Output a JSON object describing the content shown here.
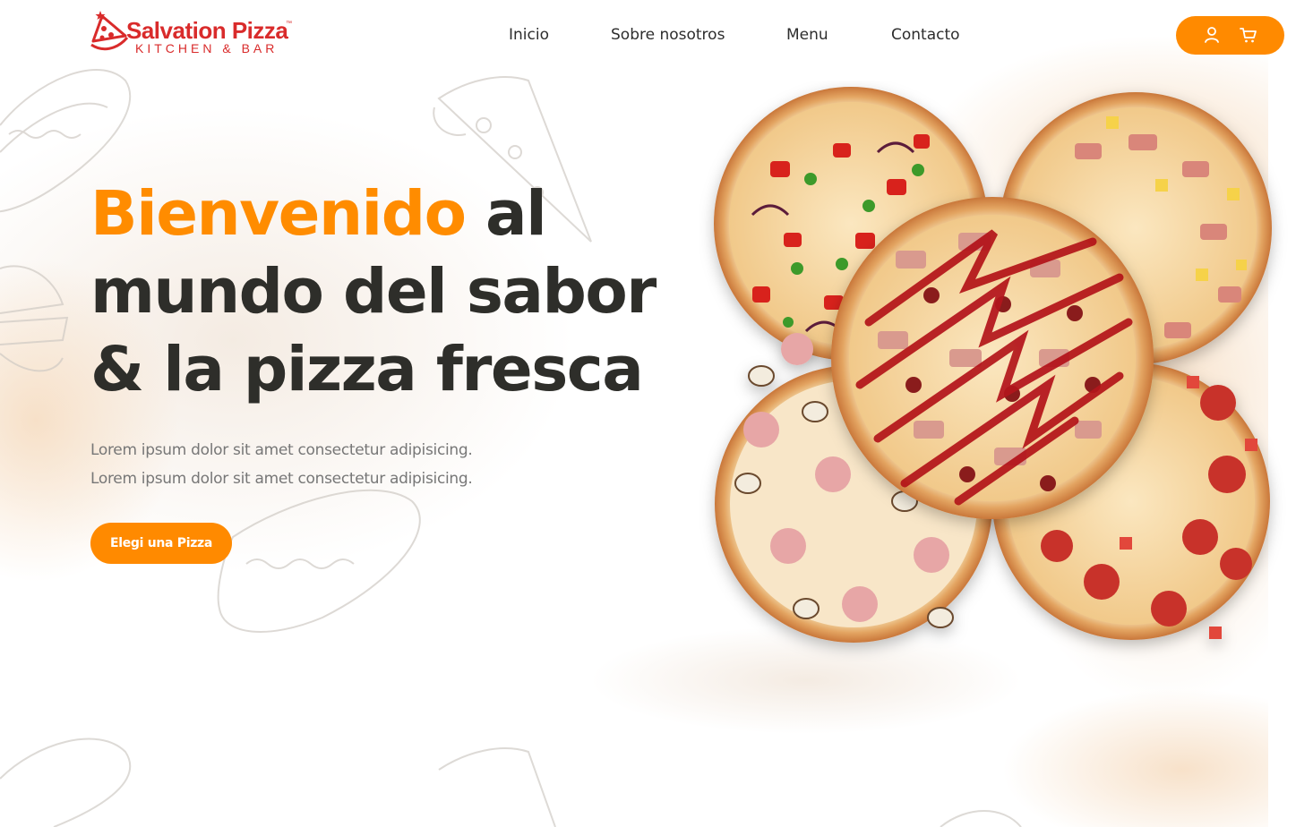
{
  "brand": {
    "name": "Salvation Pizza",
    "trademark": "™",
    "tagline": "KITCHEN & BAR"
  },
  "nav": {
    "items": [
      {
        "label": "Inicio"
      },
      {
        "label": "Sobre nosotros"
      },
      {
        "label": "Menu"
      },
      {
        "label": "Contacto"
      }
    ]
  },
  "header_actions": {
    "account_icon": "user-icon",
    "cart_icon": "cart-icon"
  },
  "hero": {
    "title_accent": "Bienvenido",
    "title_line1_rest": " al",
    "title_line2": "mundo del sabor",
    "title_line3": "& la pizza fresca",
    "paragraph_lines": [
      "Lorem ipsum dolor sit amet consectetur adipisicing.",
      "Lorem ipsum dolor sit amet consectetur adipisicing."
    ],
    "cta_label": "Elegi una Pizza"
  },
  "colors": {
    "accent": "#ff8c00",
    "brand_red": "#d92b2b",
    "heading": "#2e2e2a",
    "body_text": "#777777"
  }
}
